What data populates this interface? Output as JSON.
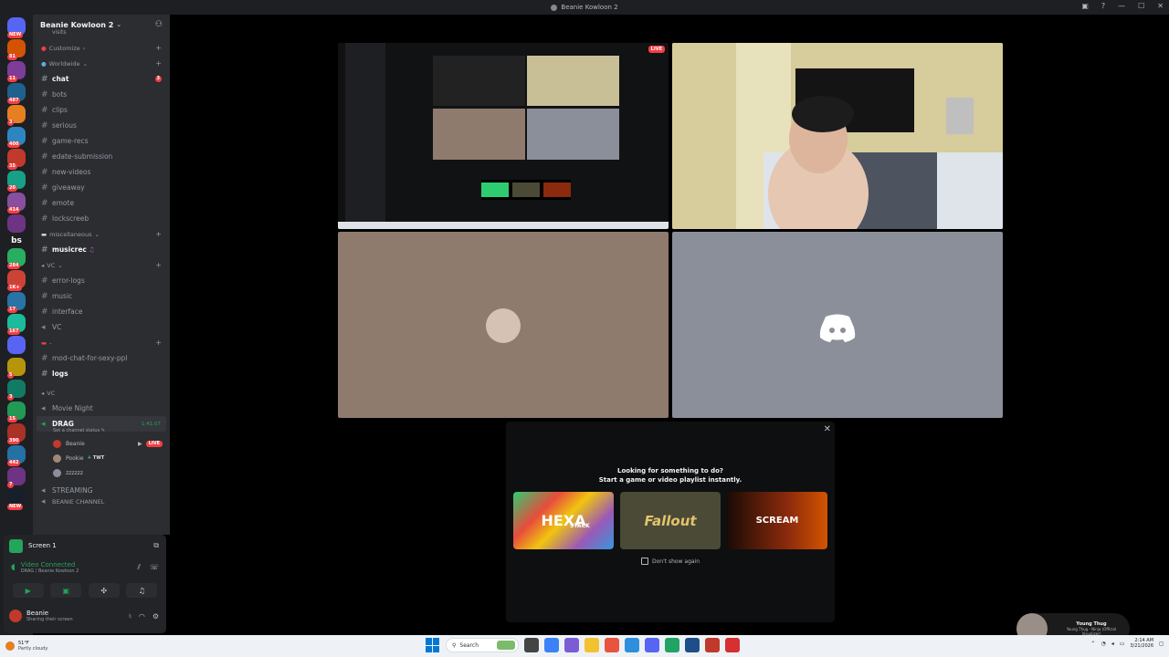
{
  "window": {
    "title": "Beanie Kowloon 2"
  },
  "rail": {
    "servers": [
      {
        "badge": "NEW",
        "color": "#5865f2"
      },
      {
        "badge": "81",
        "color": "#d35400"
      },
      {
        "badge": "11",
        "color": "#7d3c98"
      },
      {
        "badge": "487",
        "color": "#1f618d"
      },
      {
        "badge": "3",
        "color": "#e67e22"
      },
      {
        "badge": "400",
        "color": "#2e86c1"
      },
      {
        "badge": "35",
        "color": "#c0392b"
      },
      {
        "badge": "20",
        "color": "#16a085"
      },
      {
        "badge": "414",
        "color": "#884ea0"
      },
      {
        "badge": "",
        "color": "#6c3483"
      },
      {
        "badge": "284",
        "color": "#27ae60"
      },
      {
        "badge": "1K+",
        "color": "#cb4335"
      },
      {
        "badge": "17",
        "color": "#2874a6"
      },
      {
        "badge": "167",
        "color": "#1abc9c"
      },
      {
        "badge": "",
        "color": "#5865f2"
      },
      {
        "badge": "5",
        "color": "#b7950b"
      },
      {
        "badge": "3",
        "color": "#117a65"
      },
      {
        "badge": "15",
        "color": "#229954"
      },
      {
        "badge": "390",
        "color": "#a93226"
      },
      {
        "badge": "442",
        "color": "#2471a3"
      },
      {
        "badge": "7",
        "color": "#6c3483"
      },
      {
        "badge": "NEW",
        "color": "#17202a"
      }
    ],
    "bs_label": "bs"
  },
  "sidebar": {
    "server_name": "Beanie Kowloon 2",
    "partial_top": "visits",
    "customize": "Customize",
    "cat_worldwide": "Worldwide",
    "chat": "chat",
    "chat_badge": "3",
    "bots": "bots",
    "clips": "clips",
    "serious": "serious",
    "game_recs": "game-recs",
    "edate": "edate-submission",
    "new_videos": "new-videos",
    "giveaway": "giveaway",
    "emote": "emote",
    "lockscreeb": "lockscreeb",
    "cat_misc": "miscellaneous",
    "musicrec": "musicrec",
    "cat_vc": "VC",
    "error_logs": "error-logs",
    "music": "music",
    "interface": "interface",
    "vc": "VC",
    "cat_dash": "-",
    "mod_chat": "mod-chat-for-sexy-ppl",
    "logs": "logs",
    "cat_vc2": "VC",
    "movie_night": "Movie Night",
    "drag": "DRAG",
    "drag_timer": "1:41:07",
    "drag_status": "Set a channel status",
    "user_beanie": "Beanie",
    "live": "LIVE",
    "user_pookie": "Pookie",
    "twt": "TWT",
    "user_z": "zzzzzz",
    "streaming": "STREAMING",
    "beanie_channel": "BEANIE CHANNEL"
  },
  "panel": {
    "screen_label": "Screen 1",
    "vc_status": "Video Connected",
    "vc_location": "DRAG / Beanie Kowloon 2",
    "user_name": "Beanie",
    "user_status": "Sharing their screen"
  },
  "stage": {
    "live_tag": "LIVE"
  },
  "activity": {
    "title": "Looking for something to do?",
    "subtitle": "Start a game or video playlist instantly.",
    "games": [
      "HEXA",
      "Fallout",
      "SCREAM"
    ],
    "hexa_sub": "STACK",
    "dont_show": "Don't show again"
  },
  "music": {
    "artist": "Young Thug",
    "track": "Young Thug - Ninja (Official Visualizer)"
  },
  "taskbar": {
    "temp": "51°F",
    "condition": "Partly cloudy",
    "search": "Search",
    "time": "2:14 AM",
    "date": "3/21/2026"
  }
}
